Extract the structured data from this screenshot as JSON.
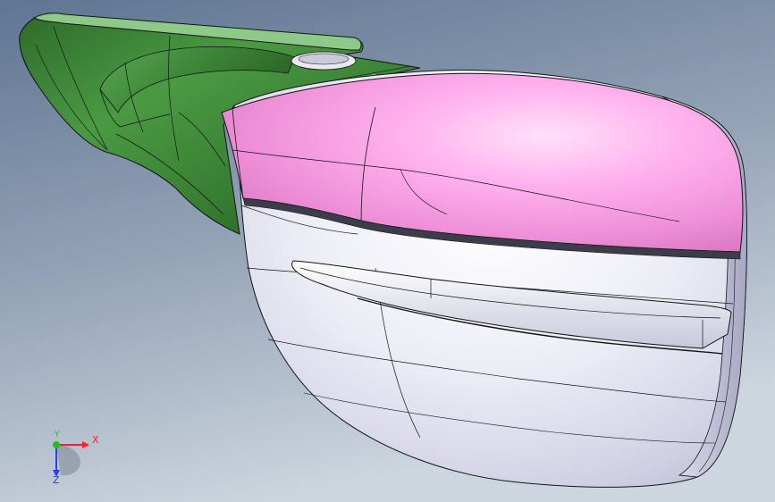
{
  "viewport": {
    "background_top": "#5f7592",
    "background_bottom": "#cbd3dd"
  },
  "model": {
    "colors": {
      "green_body": "#3f8a38",
      "green_shadow": "#22521d",
      "green_highlight": "#7fc27a",
      "pink_cap": "#f59ae0",
      "pink_highlight": "#ffd4f6",
      "white_housing": "#e6e6f4",
      "white_shadow": "#a9a9c8",
      "edge_line": "#141414"
    }
  },
  "triad": {
    "x_label": "X",
    "y_label": "Y",
    "z_label": "Z",
    "x_color": "#ff2020",
    "y_color": "#20c020",
    "z_color": "#2040ff"
  }
}
